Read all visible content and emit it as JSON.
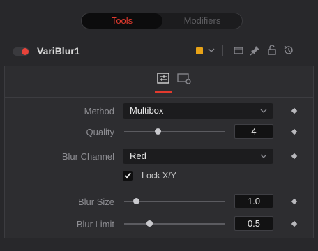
{
  "tabs": {
    "tools": "Tools",
    "modifiers": "Modifiers"
  },
  "node": {
    "name": "VariBlur1",
    "color": "#e8a317"
  },
  "controls": {
    "method": {
      "label": "Method",
      "value": "Multibox"
    },
    "quality": {
      "label": "Quality",
      "value": "4",
      "slider_fraction": 0.3
    },
    "blur_channel": {
      "label": "Blur Channel",
      "value": "Red"
    },
    "lock": {
      "label": "Lock X/Y",
      "checked": true
    },
    "blur_size": {
      "label": "Blur Size",
      "value": "1.0",
      "slider_fraction": 0.1
    },
    "blur_limit": {
      "label": "Blur Limit",
      "value": "0.5",
      "slider_fraction": 0.25
    }
  },
  "icons": {
    "header": [
      "node-toggle-icon",
      "color-swatch-icon",
      "chevron-down-icon",
      "view-icon",
      "pin-icon",
      "lock-icon",
      "reset-icon"
    ],
    "subtabs": [
      "controls-sliders-icon",
      "settings-panel-icon"
    ]
  }
}
